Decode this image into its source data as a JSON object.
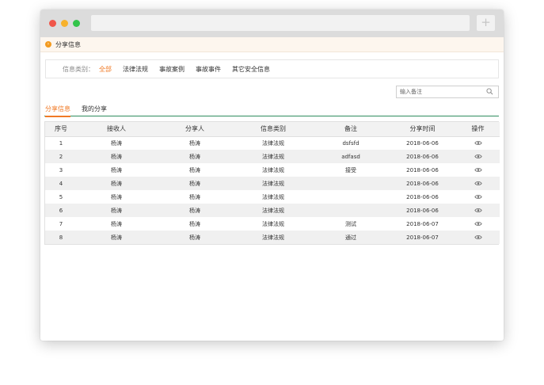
{
  "breadcrumb": {
    "title": "分享信息"
  },
  "filter": {
    "label": "信息类别：",
    "items": [
      "全部",
      "法律法规",
      "事故案例",
      "事故事件",
      "其它安全信息"
    ]
  },
  "search": {
    "placeholder": "输入备注"
  },
  "tabs": [
    {
      "label": "分享信息",
      "active": true
    },
    {
      "label": "我的分享",
      "active": false
    }
  ],
  "table": {
    "headers": [
      "序号",
      "接收人",
      "分享人",
      "信息类别",
      "备注",
      "分享时间",
      "操作"
    ],
    "rows": [
      [
        "1",
        "杨涛",
        "杨涛",
        "法律法规",
        "dsfsfd",
        "2018-06-06"
      ],
      [
        "2",
        "杨涛",
        "杨涛",
        "法律法规",
        "adfasd",
        "2018-06-06"
      ],
      [
        "3",
        "杨涛",
        "杨涛",
        "法律法规",
        "接受",
        "2018-06-06"
      ],
      [
        "4",
        "杨涛",
        "杨涛",
        "法律法规",
        "",
        "2018-06-06"
      ],
      [
        "5",
        "杨涛",
        "杨涛",
        "法律法规",
        "",
        "2018-06-06"
      ],
      [
        "6",
        "杨涛",
        "杨涛",
        "法律法规",
        "",
        "2018-06-06"
      ],
      [
        "7",
        "杨涛",
        "杨涛",
        "法律法规",
        "测试",
        "2018-06-07"
      ],
      [
        "8",
        "杨涛",
        "杨涛",
        "法律法规",
        "通过",
        "2018-06-07"
      ]
    ],
    "action_icon": "eye-icon"
  },
  "colors": {
    "accent": "#f07a26",
    "tab_line": "#2f8d5e",
    "crumb_icon": "#f39a1e"
  }
}
